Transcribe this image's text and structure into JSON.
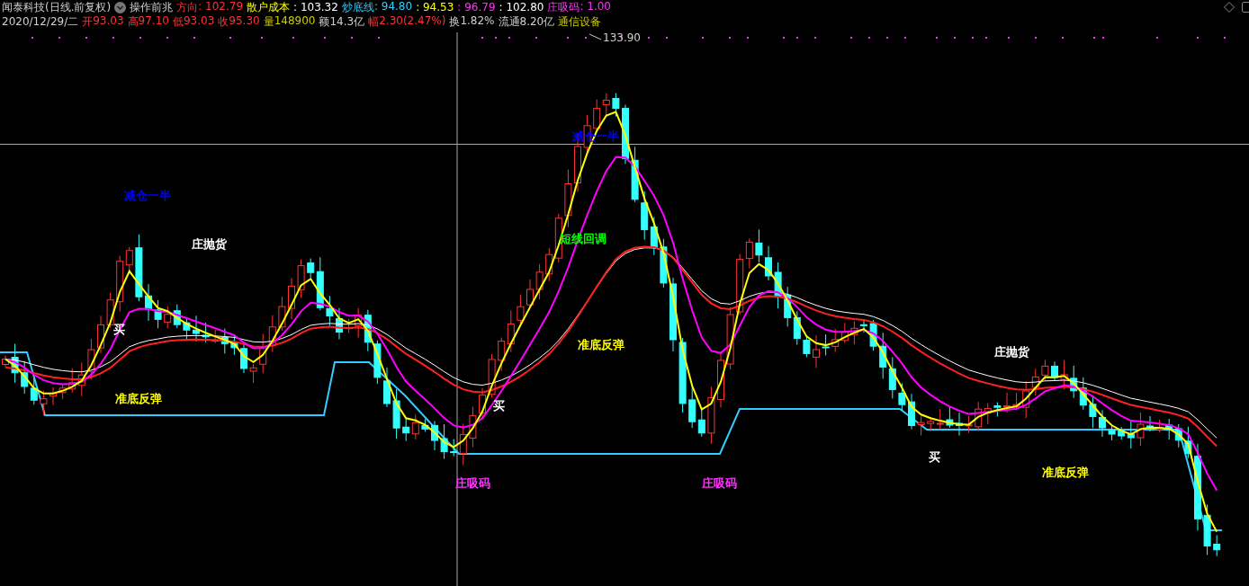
{
  "header": {
    "title": "闻泰科技(日线.前复权)",
    "indicator": "操作前兆",
    "readings": [
      {
        "label": "方向",
        "value": ": 102.79",
        "color": "#ff3333"
      },
      {
        "label": "散户成本",
        "color": "#ffff00"
      },
      {
        "value": ": 103.32",
        "color": "#ffffff"
      },
      {
        "label": "炒底线",
        "value": ": 94.80",
        "color": "#33ccff"
      },
      {
        "value": ": 94.53",
        "color": "#ffff00"
      },
      {
        "value": ": 96.79",
        "color": "#ff33ff"
      },
      {
        "value": ": 102.80",
        "color": "#ffffff"
      },
      {
        "label": "庄吸码",
        "value": ": 1.00",
        "color": "#ff33ff"
      }
    ]
  },
  "quote": {
    "date": "2020/12/29/二",
    "fields": [
      {
        "label": "开",
        "value": "93.03",
        "color": "#ff3333"
      },
      {
        "label": "高",
        "value": "97.10",
        "color": "#ff3333"
      },
      {
        "label": "低",
        "value": "93.03",
        "color": "#ff3333"
      },
      {
        "label": "收",
        "value": "95.30",
        "color": "#ff3333"
      },
      {
        "label": "量",
        "value": "148900",
        "color": "#cccc00"
      },
      {
        "label": "额",
        "value": "14.3亿",
        "color": "#d0d0d0"
      },
      {
        "label": "幅",
        "value": "2.30(2.47%)",
        "color": "#ff3333"
      },
      {
        "label": "换",
        "value": "1.82%",
        "color": "#d0d0d0"
      },
      {
        "label": "流通",
        "value": "8.20亿",
        "color": "#d0d0d0"
      }
    ],
    "sector": "通信设备"
  },
  "chart": {
    "high_label": "133.90",
    "annotations": [
      {
        "text": "减仓一半",
        "color": "#0000ff"
      },
      {
        "text": "庄抛货",
        "color": "#ffffff"
      },
      {
        "text": "买",
        "color": "#ffffff"
      },
      {
        "text": "准底反弹",
        "color": "#ffff00"
      },
      {
        "text": "减仓一半",
        "color": "#0000ff"
      },
      {
        "text": "短线回调",
        "color": "#00ff00"
      },
      {
        "text": "准底反弹",
        "color": "#ffff00"
      },
      {
        "text": "买",
        "color": "#ffffff"
      },
      {
        "text": "庄吸码",
        "color": "#ff33ff"
      },
      {
        "text": "庄吸码",
        "color": "#ff33ff"
      },
      {
        "text": "庄抛货",
        "color": "#ffffff"
      },
      {
        "text": "买",
        "color": "#ffffff"
      },
      {
        "text": "准底反弹",
        "color": "#ffff00"
      }
    ]
  }
}
